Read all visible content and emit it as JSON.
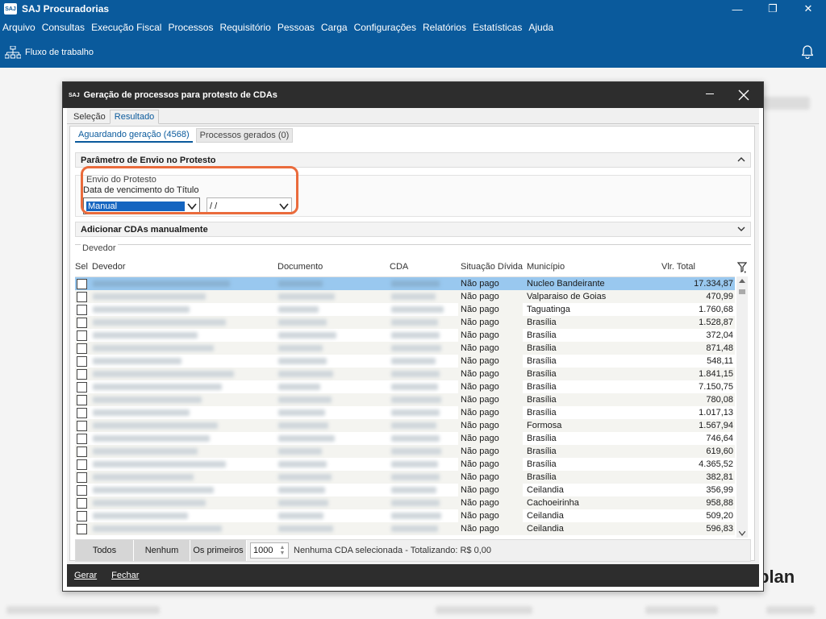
{
  "app": {
    "logo": "SAJ",
    "title": "SAJ Procuradorias",
    "menu": [
      "Arquivo",
      "Consultas",
      "Execução Fiscal",
      "Processos",
      "Requisitório",
      "Pessoas",
      "Carga",
      "Configurações",
      "Relatórios",
      "Estatísticas",
      "Ajuda"
    ],
    "toolbar": {
      "workflow_label": "Fluxo de trabalho"
    },
    "brand_fragment": "plan"
  },
  "dialog": {
    "logo": "SAJ",
    "title": "Geração de processos para protesto de CDAs",
    "tabs": [
      {
        "label": "Seleção"
      },
      {
        "label": "Resultado"
      }
    ],
    "subtabs": [
      {
        "label": "Aguardando geração (4568)"
      },
      {
        "label": "Processos gerados (0)"
      }
    ],
    "section_envio": "Parâmetro de Envio no Protesto",
    "envio": {
      "legend": "Envio do Protesto",
      "label": "Data de vencimento do Título",
      "mode_value": "Manual",
      "date_value": " /  /"
    },
    "section_add": "Adicionar CDAs manualmente",
    "devedor_legend": "Devedor",
    "columns": {
      "sel": "Sel",
      "devedor": "Devedor",
      "documento": "Documento",
      "cda": "CDA",
      "situacao": "Situação Dívida",
      "municipio": "Município",
      "total": "Vlr. Total"
    },
    "rows": [
      {
        "situacao": "Não pago",
        "municipio": "Nucleo Bandeirante",
        "total": "17.334,87"
      },
      {
        "situacao": "Não pago",
        "municipio": "Valparaiso de Goias",
        "total": "470,99"
      },
      {
        "situacao": "Não pago",
        "municipio": "Taguatinga",
        "total": "1.760,68"
      },
      {
        "situacao": "Não pago",
        "municipio": "Brasília",
        "total": "1.528,87"
      },
      {
        "situacao": "Não pago",
        "municipio": "Brasília",
        "total": "372,04"
      },
      {
        "situacao": "Não pago",
        "municipio": "Brasília",
        "total": "871,48"
      },
      {
        "situacao": "Não pago",
        "municipio": "Brasília",
        "total": "548,11"
      },
      {
        "situacao": "Não pago",
        "municipio": "Brasília",
        "total": "1.841,15"
      },
      {
        "situacao": "Não pago",
        "municipio": "Brasília",
        "total": "7.150,75"
      },
      {
        "situacao": "Não pago",
        "municipio": "Brasília",
        "total": "780,08"
      },
      {
        "situacao": "Não pago",
        "municipio": "Brasília",
        "total": "1.017,13"
      },
      {
        "situacao": "Não pago",
        "municipio": "Formosa",
        "total": "1.567,94"
      },
      {
        "situacao": "Não pago",
        "municipio": "Brasília",
        "total": "746,64"
      },
      {
        "situacao": "Não pago",
        "municipio": "Brasília",
        "total": "619,60"
      },
      {
        "situacao": "Não pago",
        "municipio": "Brasília",
        "total": "4.365,52"
      },
      {
        "situacao": "Não pago",
        "municipio": "Brasília",
        "total": "382,81"
      },
      {
        "situacao": "Não pago",
        "municipio": "Ceilandia",
        "total": "356,99"
      },
      {
        "situacao": "Não pago",
        "municipio": "Cachoeirinha",
        "total": "958,88"
      },
      {
        "situacao": "Não pago",
        "municipio": "Ceilandia",
        "total": "509,20"
      },
      {
        "situacao": "Não pago",
        "municipio": "Ceilandia",
        "total": "596,83"
      }
    ],
    "footer": {
      "todos": "Todos",
      "nenhum": "Nenhum",
      "primeiros": "Os primeiros",
      "primeiros_value": "1000",
      "status": "Nenhuma CDA selecionada - Totalizando: R$ 0,00"
    },
    "bottom": {
      "gerar": "Gerar",
      "fechar": "Fechar"
    }
  },
  "colors": {
    "chrome_blue": "#0a5a9c",
    "dialog_dark": "#2d2d2d",
    "highlight": "#ea6b3c",
    "row_selected": "#99c8ef"
  }
}
